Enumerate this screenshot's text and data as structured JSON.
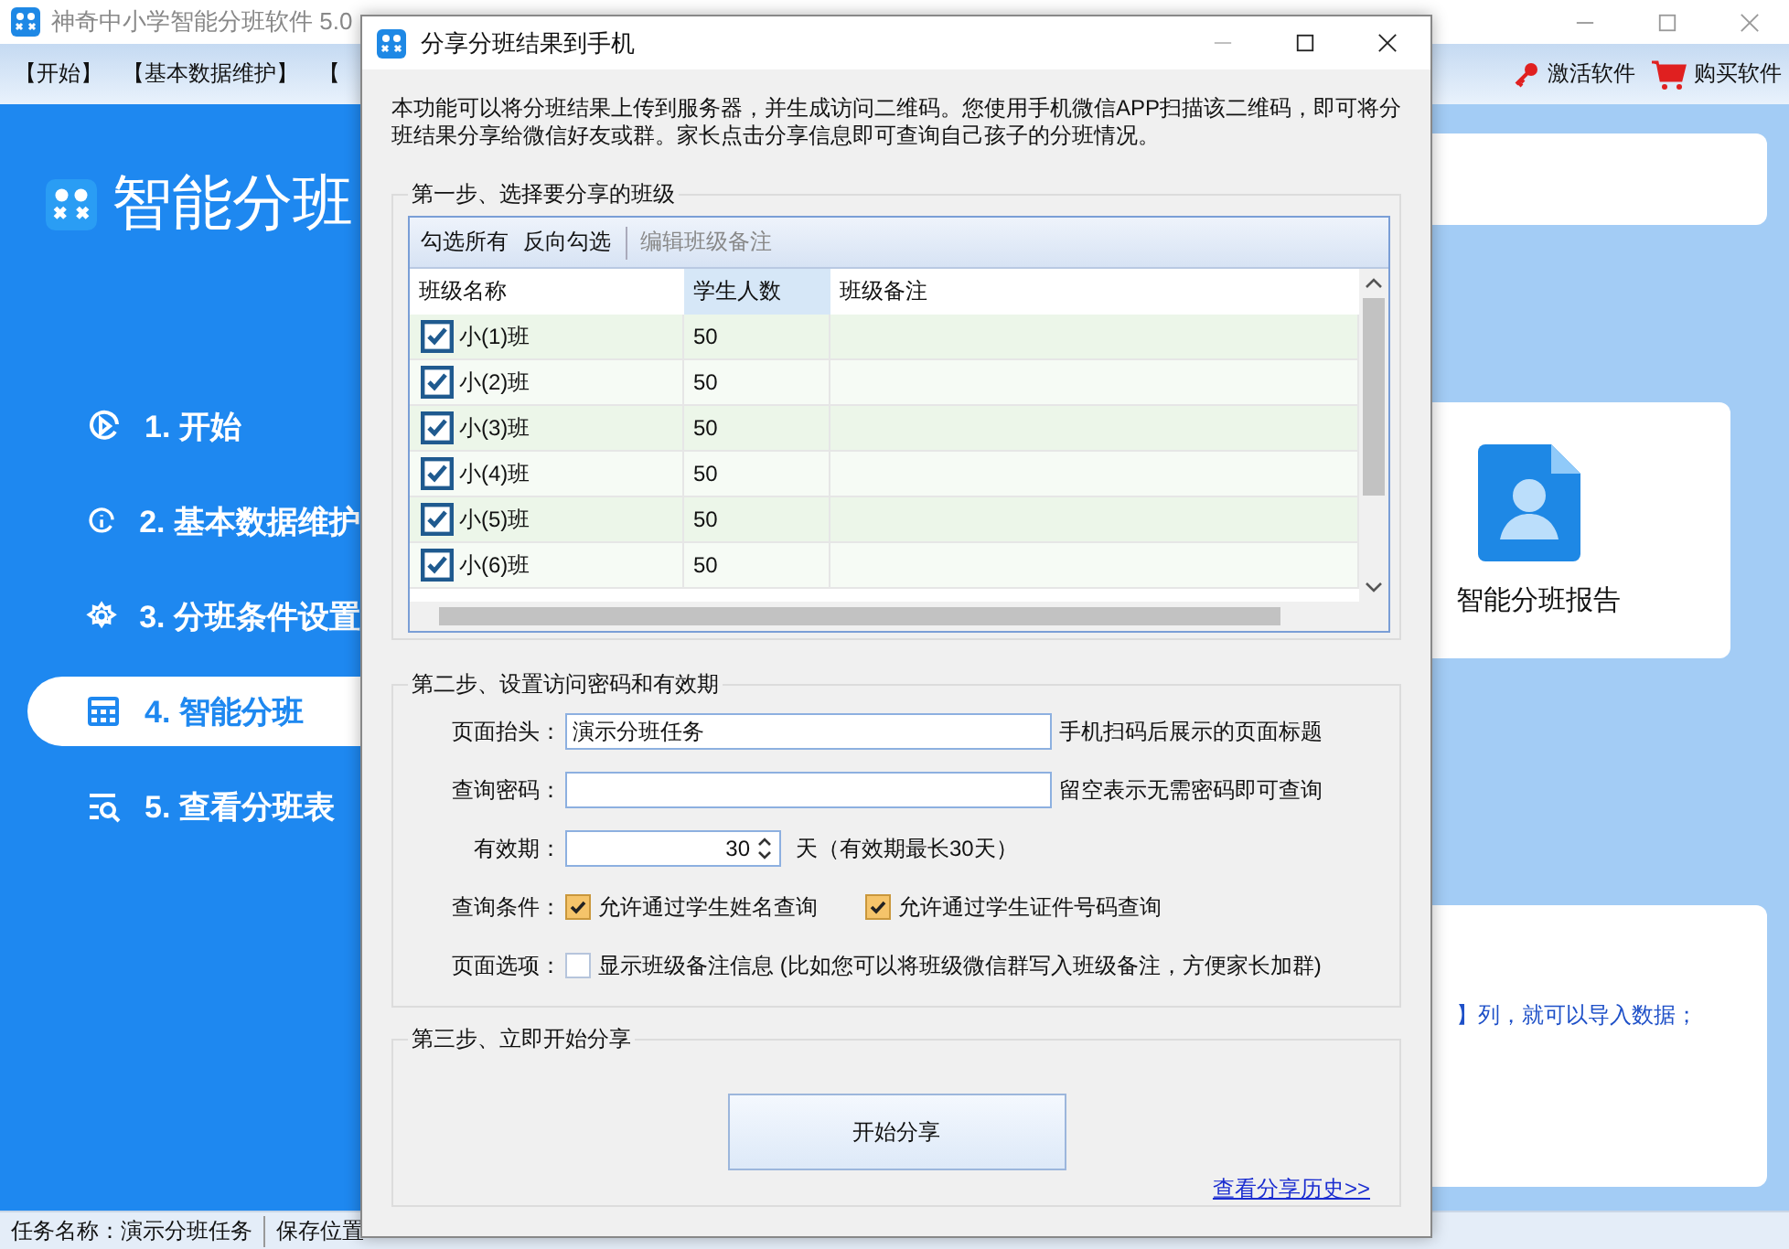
{
  "app": {
    "title": "神奇中小学智能分班软件 5.0",
    "menu": [
      "【开始】",
      "【基本数据维护】",
      "【"
    ],
    "menu_right": [
      "激活软件",
      "购买软件"
    ],
    "sidebar": {
      "logo": "智能分班",
      "items": [
        {
          "label": "1. 开始",
          "selected": false
        },
        {
          "label": "2. 基本数据维护",
          "selected": false
        },
        {
          "label": "3. 分班条件设置",
          "selected": false
        },
        {
          "label": "4. 智能分班",
          "selected": true
        },
        {
          "label": "5. 查看分班表",
          "selected": false
        }
      ]
    },
    "report_card": {
      "label": "智能分班报告"
    },
    "import_note": "】列，就可以导入数据；",
    "status_bar": [
      "任务名称：演示分班任务",
      "保存位置"
    ]
  },
  "dialog": {
    "title": "分享分班结果到手机",
    "description": "本功能可以将分班结果上传到服务器，并生成访问二维码。您使用手机微信APP扫描该二维码，即可将分班结果分享给微信好友或群。家长点击分享信息即可查询自己孩子的分班情况。",
    "step1": {
      "title": "第一步、选择要分享的班级",
      "toolbar": [
        {
          "label": "勾选所有",
          "disabled": false
        },
        {
          "label": "反向勾选",
          "disabled": false
        },
        {
          "label": "编辑班级备注",
          "disabled": true
        }
      ],
      "columns": [
        "班级名称",
        "学生人数",
        "班级备注"
      ],
      "rows": [
        {
          "name": "小(1)班",
          "count": "50",
          "checked": true
        },
        {
          "name": "小(2)班",
          "count": "50",
          "checked": true
        },
        {
          "name": "小(3)班",
          "count": "50",
          "checked": true
        },
        {
          "name": "小(4)班",
          "count": "50",
          "checked": true
        },
        {
          "name": "小(5)班",
          "count": "50",
          "checked": true
        },
        {
          "name": "小(6)班",
          "count": "50",
          "checked": true
        }
      ]
    },
    "step2": {
      "title": "第二步、设置访问密码和有效期",
      "header": {
        "label": "页面抬头：",
        "value": "演示分班任务",
        "hint": "手机扫码后展示的页面标题"
      },
      "password": {
        "label": "查询密码：",
        "hint": "留空表示无需密码即可查询"
      },
      "validity": {
        "label": "有效期：",
        "value": "30",
        "hint": "天（有效期最长30天）"
      },
      "conditions": {
        "label": "查询条件：",
        "options": [
          {
            "label": "允许通过学生姓名查询",
            "checked": true
          },
          {
            "label": "允许通过学生证件号码查询",
            "checked": true
          }
        ]
      },
      "page_options": {
        "label": "页面选项：",
        "options": [
          {
            "label": "显示班级备注信息 (比如您可以将班级微信群写入班级备注，方便家长加群)",
            "checked": false
          }
        ]
      }
    },
    "step3": {
      "title": "第三步、立即开始分享",
      "button": "开始分享",
      "link": "查看分享历史>>"
    }
  }
}
